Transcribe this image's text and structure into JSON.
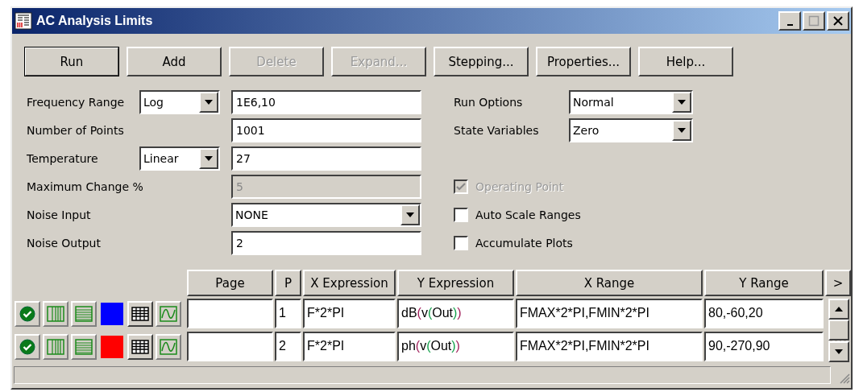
{
  "window": {
    "title": "AC Analysis Limits"
  },
  "buttons": [
    {
      "label": "Run",
      "disabled": false,
      "default": true
    },
    {
      "label": "Add",
      "disabled": false,
      "default": false
    },
    {
      "label": "Delete",
      "disabled": true,
      "default": false
    },
    {
      "label": "Expand...",
      "disabled": true,
      "default": false
    },
    {
      "label": "Stepping...",
      "disabled": false,
      "default": false
    },
    {
      "label": "Properties...",
      "disabled": false,
      "default": false
    },
    {
      "label": "Help...",
      "disabled": false,
      "default": false
    }
  ],
  "left_fields": [
    {
      "label": "Frequency Range",
      "mode": "Log",
      "input": {
        "kind": "text",
        "value": "1E6,10",
        "disabled": false
      }
    },
    {
      "label": "Number of Points",
      "input": {
        "kind": "text",
        "value": "1001",
        "disabled": false
      }
    },
    {
      "label": "Temperature",
      "mode": "Linear",
      "input": {
        "kind": "text",
        "value": "27",
        "disabled": false
      }
    },
    {
      "label": "Maximum Change %",
      "input": {
        "kind": "text",
        "value": "5",
        "disabled": true
      }
    },
    {
      "label": "Noise Input",
      "input": {
        "kind": "dropdown",
        "value": "NONE",
        "disabled": false
      }
    },
    {
      "label": "Noise Output",
      "input": {
        "kind": "text",
        "value": "2",
        "disabled": false
      }
    }
  ],
  "right_fields": [
    {
      "label": "Run Options",
      "value": "Normal"
    },
    {
      "label": "State Variables",
      "value": "Zero"
    }
  ],
  "checkboxes": [
    {
      "label": "Operating Point",
      "checked": true,
      "disabled": true
    },
    {
      "label": "Auto Scale Ranges",
      "checked": false,
      "disabled": false
    },
    {
      "label": "Accumulate Plots",
      "checked": false,
      "disabled": false
    }
  ],
  "table": {
    "columns": [
      "Page",
      "P",
      "X Expression",
      "Y Expression",
      "X Range",
      "Y Range"
    ],
    "more_button": ">",
    "rows": [
      {
        "color": "#0000ff",
        "page": "",
        "p": "1",
        "x_expression": "F*2*PI",
        "y_expression": "dB(v(Out))",
        "x_range": "FMAX*2*PI,FMIN*2*PI",
        "y_range": "80,-60,20"
      },
      {
        "color": "#ff0000",
        "page": "",
        "p": "2",
        "x_expression": "F*2*PI",
        "y_expression": "ph(v(Out))",
        "x_range": "FMAX*2*PI,FMIN*2*PI",
        "y_range": "90,-270,90"
      }
    ]
  }
}
